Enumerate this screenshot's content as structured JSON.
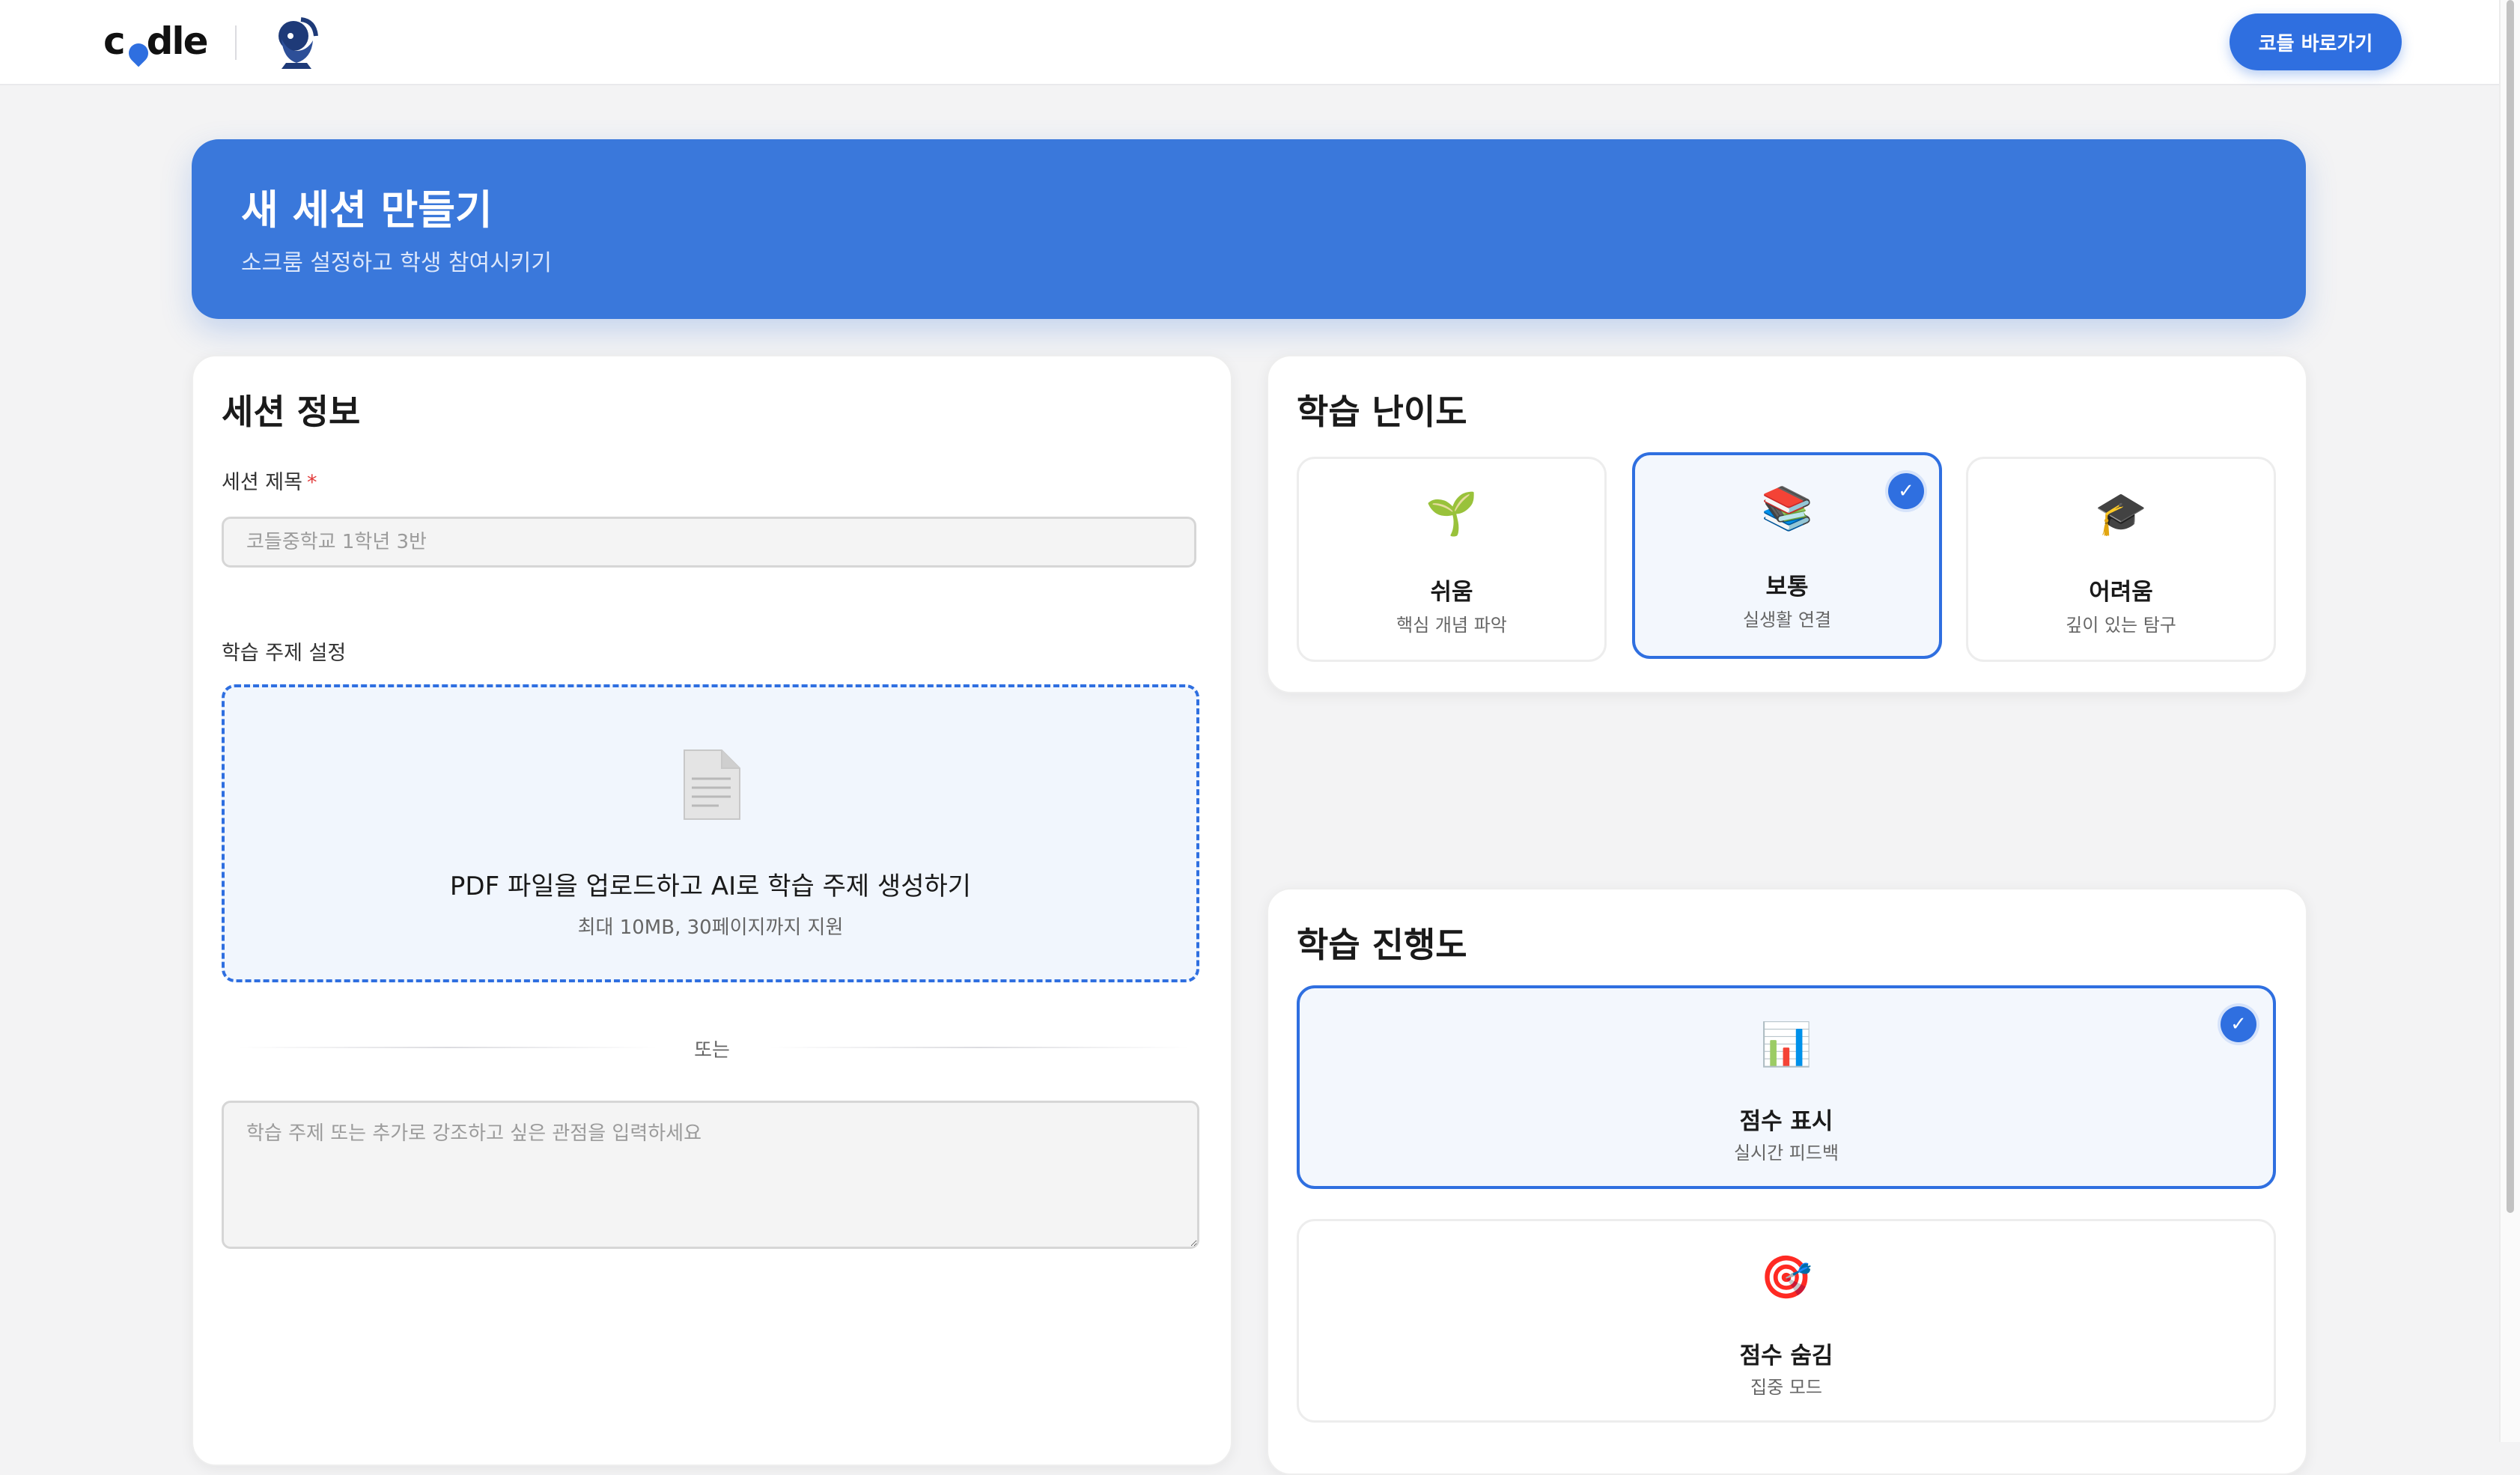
{
  "nav": {
    "logo_text": "c dle",
    "cta_label": "코들 바로가기"
  },
  "hero": {
    "title": "새 세션 만들기",
    "subtitle": "소크룸 설정하고 학생 참여시키기"
  },
  "session_info": {
    "title": "세션 정보",
    "session_title_label": "세션 제목",
    "required_mark": "*",
    "session_title_placeholder": "코들중학교 1학년 3반",
    "topic_label": "학습 주제 설정",
    "upload_title": "PDF 파일을 업로드하고 AI로 학습 주제 생성하기",
    "upload_sub": "최대 10MB, 30페이지까지 지원",
    "or_text": "또는",
    "topic_placeholder": "학습 주제 또는 추가로 강조하고 싶은 관점을 입력하세요"
  },
  "difficulty": {
    "title": "학습 난이도",
    "options": [
      {
        "emoji": "🌱",
        "label": "쉬움",
        "desc": "핵심 개념 파악",
        "selected": false
      },
      {
        "emoji": "📚",
        "label": "보통",
        "desc": "실생활 연결",
        "selected": true
      },
      {
        "emoji": "🎓",
        "label": "어려움",
        "desc": "깊이 있는 탐구",
        "selected": false
      }
    ]
  },
  "progress": {
    "title": "학습 진행도",
    "options": [
      {
        "emoji": "📊",
        "label": "점수 표시",
        "desc": "실시간 피드백",
        "selected": true
      },
      {
        "emoji": "🎯",
        "label": "점수 숨김",
        "desc": "집중 모드",
        "selected": false
      }
    ]
  },
  "colors": {
    "accent": "#2f6fe0",
    "hero_bg": "#3a78db",
    "page_bg": "#f3f3f4"
  }
}
